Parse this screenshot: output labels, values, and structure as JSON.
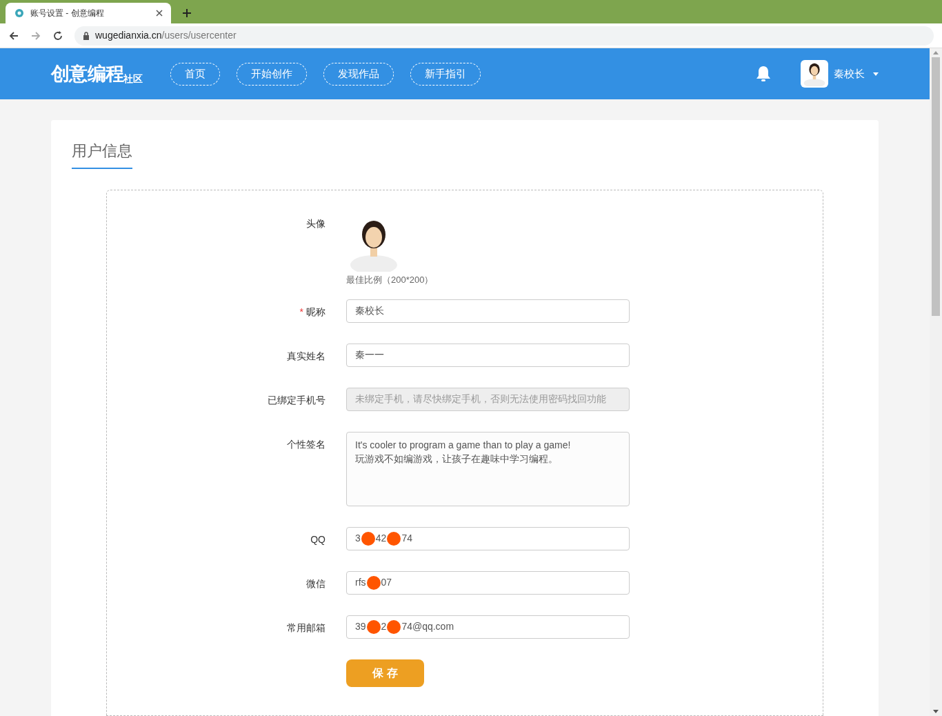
{
  "browser": {
    "tab_title": "账号设置 - 创意编程",
    "url_host": "wugedianxia.cn",
    "url_path": "/users/usercenter"
  },
  "header": {
    "logo": "创意编程",
    "logo_suffix": "社区",
    "nav": [
      {
        "label": "首页"
      },
      {
        "label": "开始创作"
      },
      {
        "label": "发现作品"
      },
      {
        "label": "新手指引"
      }
    ],
    "user_name": "秦校长"
  },
  "section_title": "用户信息",
  "avatar": {
    "label": "头像",
    "hint": "最佳比例（200*200）"
  },
  "fields": [
    {
      "kind": "input",
      "label": "昵称",
      "required": true,
      "disabled": false,
      "value_parts": [
        "秦校长"
      ]
    },
    {
      "kind": "input",
      "label": "真实姓名",
      "required": false,
      "disabled": false,
      "value_parts": [
        "秦一一"
      ]
    },
    {
      "kind": "input",
      "label": "已绑定手机号",
      "required": false,
      "disabled": true,
      "placeholder": "未绑定手机，请尽快绑定手机，否则无法使用密码找回功能"
    },
    {
      "kind": "textarea",
      "label": "个性签名",
      "required": false,
      "disabled": false,
      "lines": [
        "It's cooler to program a game than to play a game!",
        "玩游戏不如编游戏，让孩子在趣味中学习编程。"
      ]
    },
    {
      "kind": "input",
      "label": "QQ",
      "required": false,
      "disabled": false,
      "value_parts": [
        "3",
        "42",
        "74"
      ]
    },
    {
      "kind": "input",
      "label": "微信",
      "required": false,
      "disabled": false,
      "value_parts": [
        "rfs",
        "07"
      ]
    },
    {
      "kind": "input",
      "label": "常用邮箱",
      "required": false,
      "disabled": false,
      "value_parts": [
        "39",
        "2",
        "74@qq.com"
      ]
    }
  ],
  "save_button": "保 存",
  "required_mark": "*"
}
